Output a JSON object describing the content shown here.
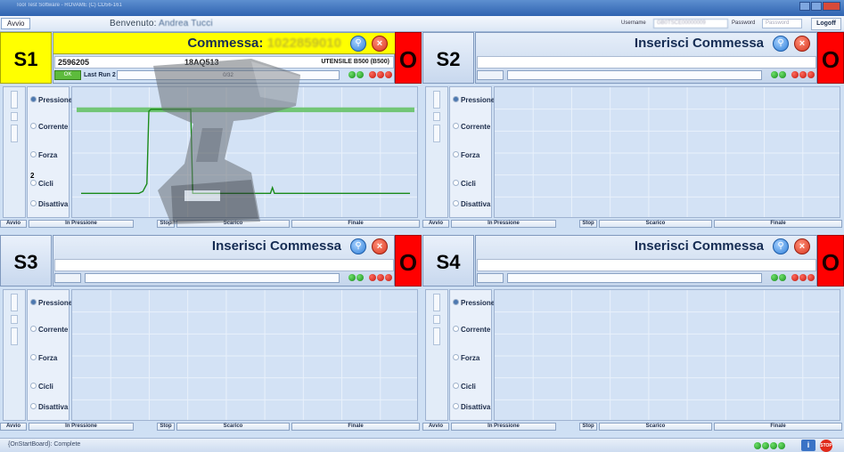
{
  "window": {
    "title": "Tool Test Software - ROVAME (C) CD56-161"
  },
  "topbar": {
    "avvio": "Avvio",
    "welcome_prefix": "Benvenuto:",
    "welcome_user": "Andrea Tucci",
    "username_label": "Username",
    "username_value": "GB0TSCE00000009",
    "password_label": "Password",
    "password_placeholder": "Password",
    "logoff": "Logoff"
  },
  "stations": [
    {
      "code": "S1",
      "title_prefix": "Commessa:",
      "commessa": "1022859010",
      "field1": "2596205",
      "field2": "18AQ513",
      "utensile": "UTENSILE B500 (B500)",
      "last_run_label": "Last Run 2",
      "progress_text": "0/32",
      "status": "O",
      "cycles_count": "2",
      "params": [
        "Pressione",
        "Corrente",
        "Forza",
        "Cicli",
        "Disattiva"
      ],
      "selected_param": "Pressione"
    },
    {
      "code": "S2",
      "title": "Inserisci Commessa",
      "status": "O",
      "params": [
        "Pressione",
        "Corrente",
        "Forza",
        "Cicli",
        "Disattiva"
      ],
      "selected_param": "Pressione"
    },
    {
      "code": "S3",
      "title": "Inserisci Commessa",
      "status": "O",
      "params": [
        "Pressione",
        "Corrente",
        "Forza",
        "Cicli",
        "Disattiva"
      ],
      "selected_param": "Pressione"
    },
    {
      "code": "S4",
      "title": "Inserisci Commessa",
      "status": "O",
      "params": [
        "Pressione",
        "Corrente",
        "Forza",
        "Cicli",
        "Disattiva"
      ],
      "selected_param": "Pressione"
    }
  ],
  "footer_buttons": [
    "Avvio",
    "In Pressione",
    "Stop",
    "Scarico",
    "Finale"
  ],
  "colors": {
    "active_header": "#ffff00",
    "status_red": "#ff0000",
    "led_green": "#1aa01e",
    "led_red": "#d0160d",
    "trace_green": "#1a8a1a",
    "tolerance_band": "#5fc05f"
  },
  "s1_trace": {
    "type": "line",
    "x": [
      0,
      58,
      62,
      66,
      68,
      70,
      110,
      112,
      114,
      116,
      190,
      192,
      194,
      330
    ],
    "y": [
      10,
      10,
      12,
      20,
      96,
      98,
      98,
      10,
      10,
      10,
      10,
      16,
      10,
      10
    ],
    "band": [
      95,
      100
    ],
    "ylim": [
      0,
      110
    ]
  },
  "statusbar": {
    "message": "{OnStartBoard}: Complete",
    "info_icon": "info-icon",
    "stop_icon": "stop-icon",
    "stop_label": "STOP"
  }
}
